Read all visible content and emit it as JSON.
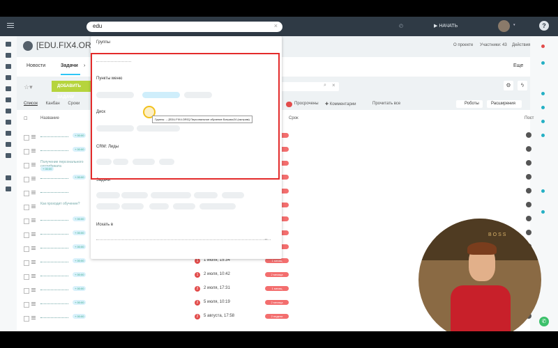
{
  "topbar": {
    "search_value": "edu",
    "start_label": "НАЧАТЬ",
    "help_label": "?"
  },
  "header": {
    "title": "[EDU.FIX4.ORG] П",
    "links": [
      "О проекте",
      "Участники: 43",
      "Действия"
    ]
  },
  "tabs": [
    "Новости",
    "Задачи"
  ],
  "tabs_more": "Еще",
  "toolbar": {
    "add_button": "ДОБАВИТЬ ЗАДАЧУ"
  },
  "views": [
    "Список",
    "Канбан",
    "Сроки"
  ],
  "filters": {
    "overdue": "Просрочены",
    "comments": "Комментарии",
    "read_all": "Прочитать все",
    "robots": "Роботы",
    "extensions": "Расширения"
  },
  "columns": [
    "Название",
    "Срок",
    "Пост"
  ],
  "tasks": [
    {
      "title": "",
      "badge": "+ 00:00"
    },
    {
      "title": "",
      "badge": "+ 00:00"
    },
    {
      "title": "Получение персонального сертификата",
      "badge": "+ 00:00"
    },
    {
      "title": "",
      "badge": "+ 00:00"
    },
    {
      "title": "",
      "badge": ""
    },
    {
      "title": "Как проходит обучение?",
      "badge": ""
    },
    {
      "title": "",
      "badge": "+ 00:00"
    },
    {
      "title": "",
      "badge": "+ 00:00"
    },
    {
      "title": "",
      "badge": "+ 00:00"
    },
    {
      "title": "",
      "badge": "+ 00:00",
      "num": "1",
      "date": "1 июля, 15:34",
      "tag": "1 месяц"
    },
    {
      "title": "",
      "badge": "+ 00:00",
      "num": "1",
      "date": "2 июля, 10:42",
      "tag": "2 месяца"
    },
    {
      "title": "",
      "badge": "+ 00:00",
      "num": "2",
      "date": "2 июля, 17:31",
      "tag": "1 месяц"
    },
    {
      "title": "",
      "badge": "+ 00:00",
      "num": "2",
      "date": "5 июля, 10:19",
      "tag": "2 месяца"
    },
    {
      "title": "",
      "badge": "+ 00:00",
      "num": "2",
      "date": "5 августа, 17:58",
      "tag": "2 недели"
    }
  ],
  "dropdown": {
    "sections": [
      "Группы",
      "Пункты меню",
      "Диск",
      "CRM: Лиды",
      "Задачи",
      "Искать в"
    ]
  },
  "tooltip": "Группы → [EDU.FIX4.ORG] Персональное обучение Битрикс24 (экстрим)",
  "webcam": {
    "wall_text": "BOSS"
  }
}
